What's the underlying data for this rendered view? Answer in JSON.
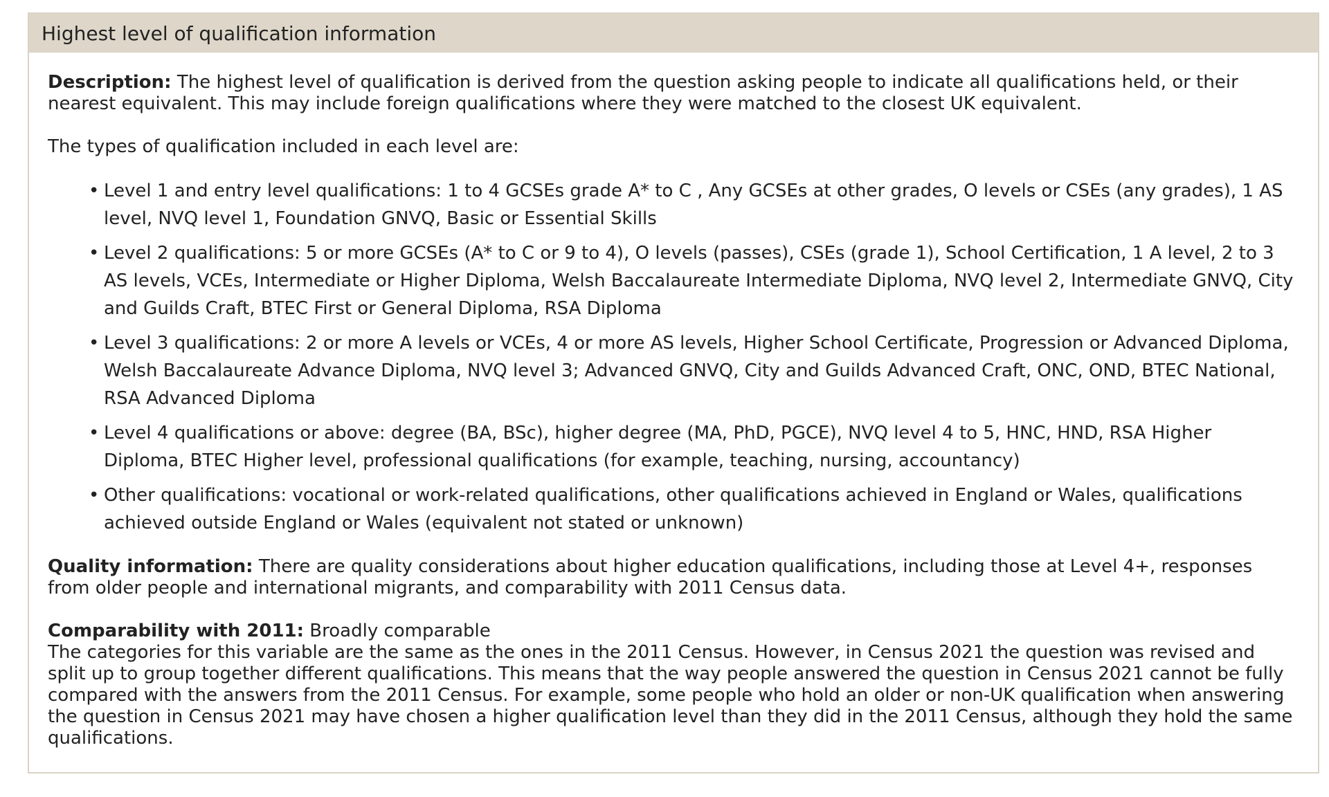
{
  "panel": {
    "title": "Highest level of qualification information"
  },
  "description": {
    "label": "Description:",
    "text": " The highest level of qualification is derived from the question asking people to indicate all qualifications held, or their nearest equivalent. This may include foreign qualifications where they were matched to the closest UK equivalent."
  },
  "intro": "The types of qualification included in each level are:",
  "levels": [
    {
      "bullet": "•",
      "text": "Level 1 and entry level qualifications: 1 to 4 GCSEs grade A* to C , Any GCSEs at other grades, O levels or CSEs (any grades), 1 AS level, NVQ level 1, Foundation GNVQ, Basic or Essential Skills"
    },
    {
      "bullet": "•",
      "text": "Level 2 qualifications: 5 or more GCSEs (A* to C or 9 to 4), O levels (passes), CSEs (grade 1), School Certification, 1 A level, 2 to 3 AS levels, VCEs, Intermediate or Higher Diploma, Welsh Baccalaureate Intermediate Diploma, NVQ level 2, Intermediate GNVQ, City and Guilds Craft, BTEC First or General Diploma, RSA Diploma"
    },
    {
      "bullet": "•",
      "text": "Level 3 qualifications: 2 or more A levels or VCEs, 4 or more AS levels, Higher School Certificate, Progression or Advanced Diploma, Welsh Baccalaureate Advance Diploma, NVQ level 3; Advanced GNVQ, City and Guilds Advanced Craft, ONC, OND, BTEC National, RSA Advanced Diploma"
    },
    {
      "bullet": "•",
      "text": "Level 4 qualifications or above: degree (BA, BSc), higher degree (MA, PhD, PGCE), NVQ level 4 to 5, HNC, HND, RSA Higher Diploma, BTEC Higher level, professional qualifications (for example, teaching, nursing, accountancy)"
    },
    {
      "bullet": "•",
      "text": "Other qualifications: vocational or work-related qualifications, other qualifications achieved in England or Wales, qualifications achieved outside England or Wales (equivalent not stated or unknown)"
    }
  ],
  "quality": {
    "label": "Quality information:",
    "text": " There are quality considerations about higher education qualifications, including those at Level 4+, responses from older people and international migrants, and comparability with 2011 Census data."
  },
  "comparability": {
    "label": "Comparability with 2011:",
    "value": " Broadly comparable",
    "text": "The categories for this variable are the same as the ones in the 2011 Census. However, in Census 2021 the question was revised and split up to group together different qualifications. This means that the way people answered the question in Census 2021 cannot be fully compared with the answers from the 2011 Census. For example, some people who hold an older or non-UK qualification when answering the question in Census 2021 may have chosen a higher qualification level than they did in the 2011 Census, although they hold the same qualifications."
  }
}
